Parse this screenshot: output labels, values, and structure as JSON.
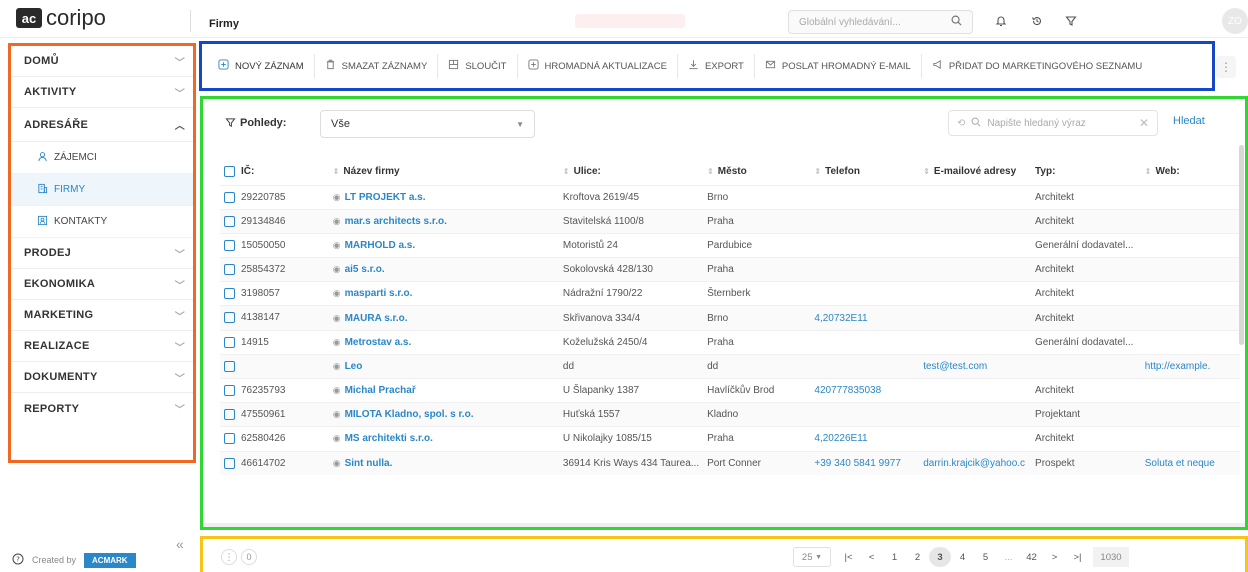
{
  "app": {
    "logo_mark": "ac",
    "logo_text": "coripo",
    "page_title": "Firmy",
    "global_search_placeholder": "Globální vyhledávání...",
    "avatar_initials": "ZO"
  },
  "sidebar": {
    "sections": [
      {
        "label": "DOMŮ"
      },
      {
        "label": "AKTIVITY"
      },
      {
        "label": "ADRESÁŘE"
      }
    ],
    "subitems": [
      {
        "label": "ZÁJEMCI"
      },
      {
        "label": "FIRMY"
      },
      {
        "label": "KONTAKTY"
      }
    ],
    "sections_after": [
      {
        "label": "PRODEJ"
      },
      {
        "label": "EKONOMIKA"
      },
      {
        "label": "MARKETING"
      },
      {
        "label": "REALIZACE"
      },
      {
        "label": "DOKUMENTY"
      },
      {
        "label": "REPORTY"
      }
    ],
    "created_by": "Created by",
    "brand": "ACMARK"
  },
  "toolbar": {
    "new_record": "NOVÝ ZÁZNAM",
    "delete_records": "SMAZAT ZÁZNAMY",
    "merge": "SLOUČIT",
    "bulk_update": "HROMADNÁ AKTUALIZACE",
    "export": "EXPORT",
    "bulk_email": "POSLAT HROMADNÝ E-MAIL",
    "add_marketing": "PŘIDAT DO MARKETINGOVÉHO SEZNAMU"
  },
  "grid": {
    "views_label": "Pohledy:",
    "views_value": "Vše",
    "search_placeholder": "Napište hledaný výraz",
    "search_button": "Hledat",
    "columns": [
      "IČ:",
      "Název firmy",
      "Ulice:",
      "Město",
      "Telefon",
      "E-mailové adresy",
      "Typ:",
      "Web:"
    ],
    "rows": [
      [
        "29220785",
        "LT PROJEKT a.s.",
        "Kroftova 2619/45",
        "Brno",
        "",
        "",
        "Architekt",
        ""
      ],
      [
        "29134846",
        "mar.s architects s.r.o.",
        "Stavitelská 1100/8",
        "Praha",
        "",
        "",
        "Architekt",
        ""
      ],
      [
        "15050050",
        "MARHOLD a.s.",
        "Motoristů 24",
        "Pardubice",
        "",
        "",
        "Generální dodavatel...",
        ""
      ],
      [
        "25854372",
        "ai5 s.r.o.",
        "Sokolovská 428/130",
        "Praha",
        "",
        "",
        "Architekt",
        ""
      ],
      [
        "3198057",
        "masparti s.r.o.",
        "Nádražní 1790/22",
        "Šternberk",
        "",
        "",
        "Architekt",
        ""
      ],
      [
        "4138147",
        "MAURA s.r.o.",
        "Skřivanova 334/4",
        "Brno",
        "4,20732E11",
        "",
        "Architekt",
        ""
      ],
      [
        "14915",
        "Metrostav a.s.",
        "Koželužská 2450/4",
        "Praha",
        "",
        "",
        "Generální dodavatel...",
        ""
      ],
      [
        "",
        "Leo",
        "dd",
        "dd",
        "",
        "test@test.com",
        "",
        "http://example."
      ],
      [
        "76235793",
        "Michal Prachař",
        "U Šlapanky 1387",
        "Havlíčkův Brod",
        "420777835038",
        "",
        "Architekt",
        ""
      ],
      [
        "47550961",
        "MILOTA Kladno, spol. s r.o.",
        "Huťská 1557",
        "Kladno",
        "",
        "",
        "Projektant",
        ""
      ],
      [
        "62580426",
        "MS architekti s.r.o.",
        "U Nikolajky 1085/15",
        "Praha",
        "4,20226E11",
        "",
        "Architekt",
        ""
      ],
      [
        "46614702",
        "Sint nulla.",
        "36914 Kris Ways 434 Taurea...",
        "Port Conner",
        "+39 340 5841 9977",
        "darrin.krajcik@yahoo.c",
        "Prospekt",
        "Soluta et neque"
      ]
    ]
  },
  "pager": {
    "selected_count": "0",
    "page_size": "25",
    "pages": [
      "1",
      "2",
      "3",
      "4",
      "5",
      "...",
      "42"
    ],
    "active_page": "3",
    "total": "1030"
  }
}
